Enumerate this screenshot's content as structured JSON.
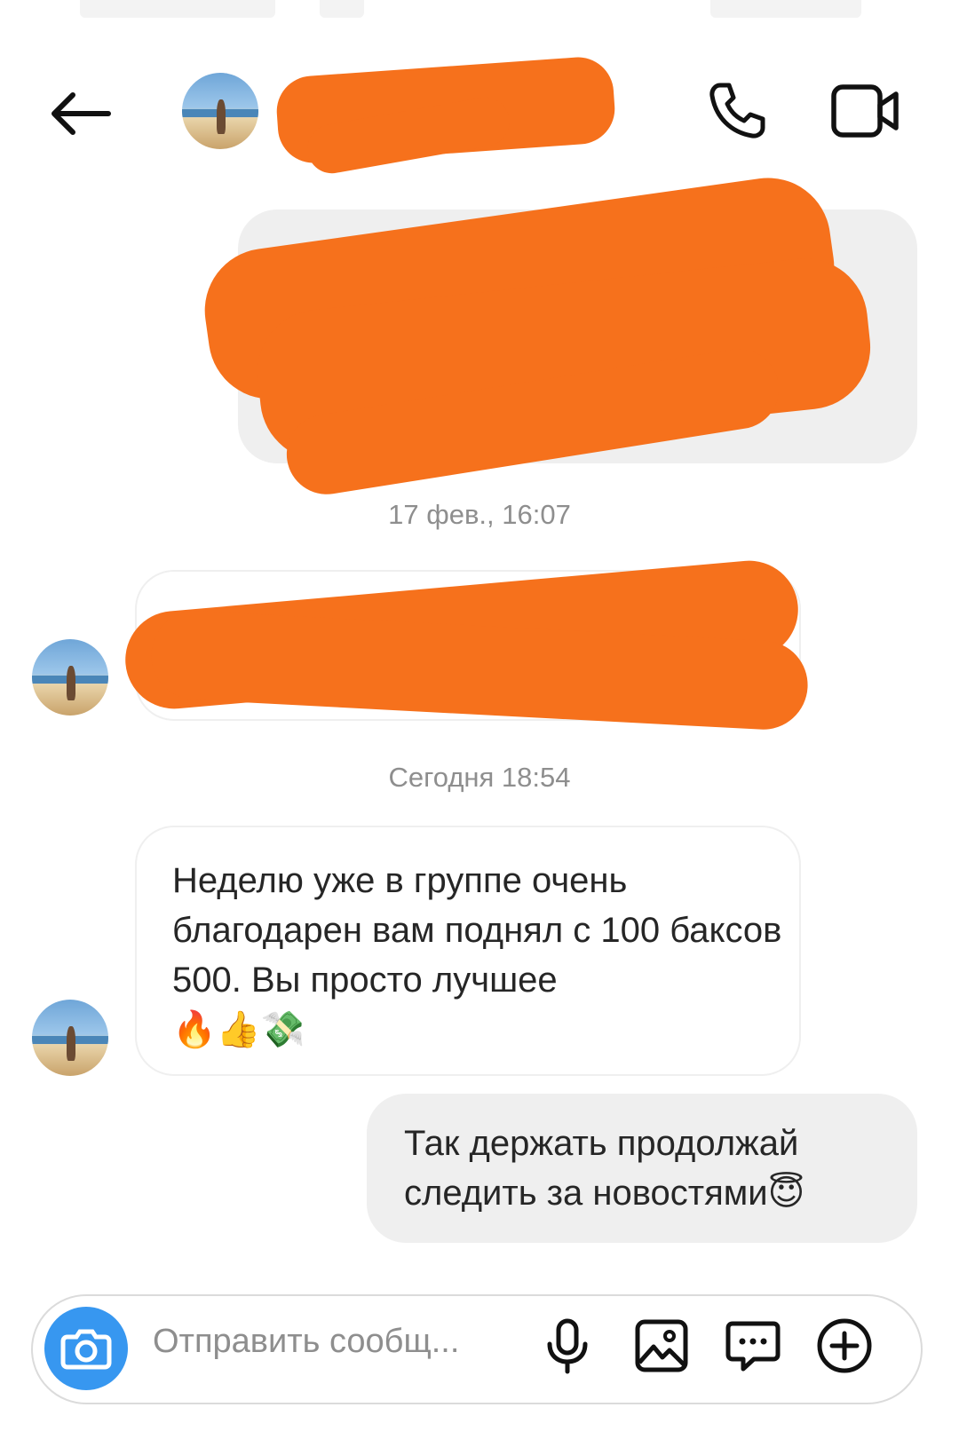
{
  "header": {
    "contact_name": "",
    "back_label": "back",
    "icons": {
      "back": "arrow-left-icon",
      "call": "phone-icon",
      "video": "video-camera-icon"
    }
  },
  "messages": [
    {
      "direction": "outgoing",
      "text": "",
      "redacted": true
    },
    {
      "timestamp": "17 фев., 16:07"
    },
    {
      "direction": "incoming",
      "text": "",
      "redacted": true
    },
    {
      "timestamp": "Сегодня 18:54"
    },
    {
      "direction": "incoming",
      "text": "Неделю уже в группе очень благодарен вам поднял с 100 баксов 500. Вы просто лучшее",
      "emoji": "🔥👍💸"
    },
    {
      "direction": "outgoing",
      "text": "Так держать продолжай следить за новостями",
      "emoji": "😇"
    }
  ],
  "composer": {
    "placeholder": "Отправить сообщ...",
    "icons": [
      "camera-icon",
      "microphone-icon",
      "gallery-icon",
      "sticker-chat-icon",
      "plus-circle-icon"
    ]
  },
  "colors": {
    "accent": "#3797f0",
    "redaction": "#f6711c",
    "bubble_out": "#efefef",
    "timestamp": "#8e8e8e"
  }
}
